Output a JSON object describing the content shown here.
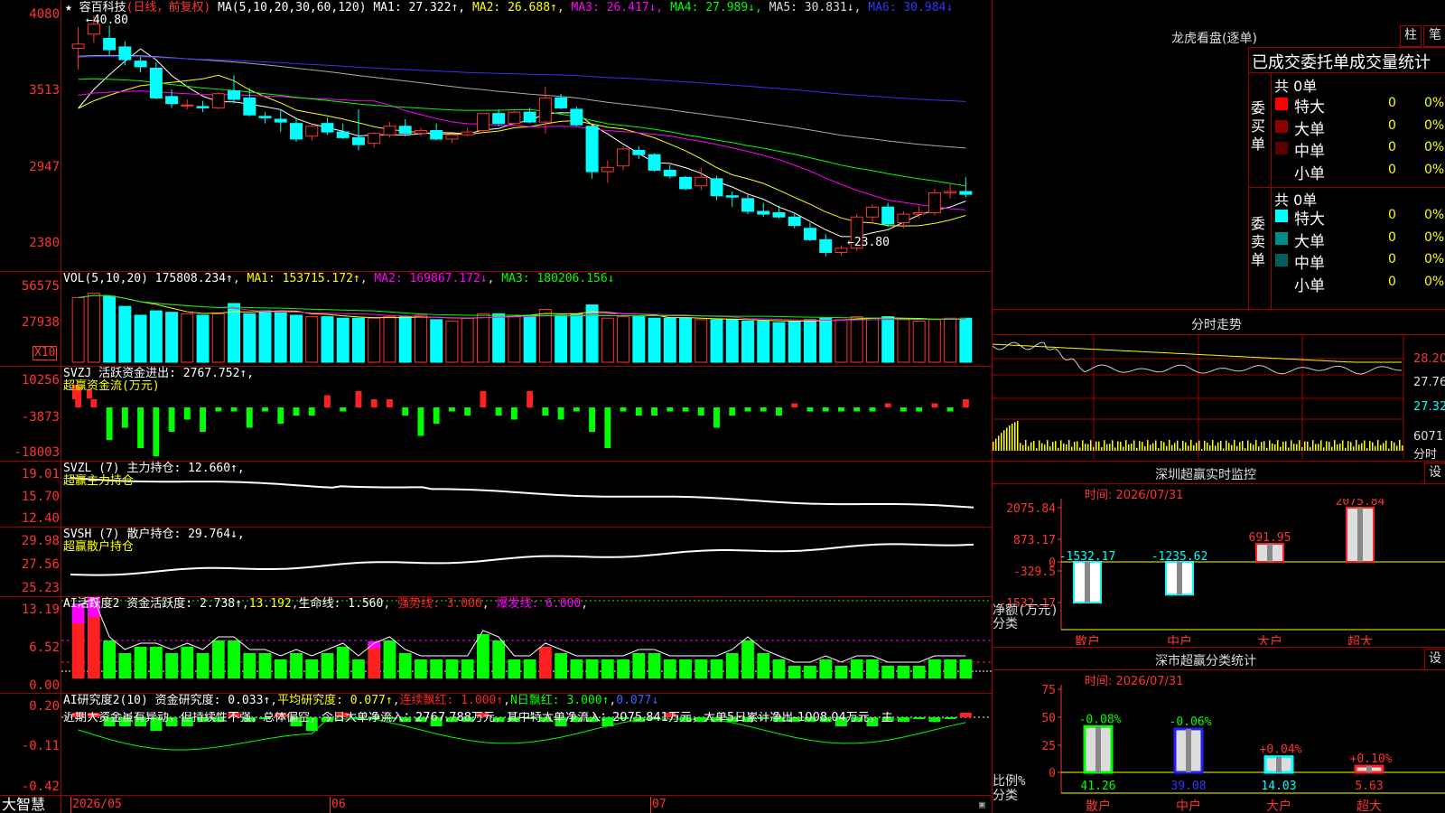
{
  "main": {
    "header": {
      "star": "★",
      "name": "容百科技",
      "mode": "(日线，前复权)",
      "ma_title": "MA(5,10,20,30,60,120)",
      "items": [
        {
          "text": "MA1: 27.322↑",
          "color": "#ffffff"
        },
        {
          "text": "MA2: 26.688↑",
          "color": "#ffff00"
        },
        {
          "text": "MA3: 26.417↓",
          "color": "#ff00ff"
        },
        {
          "text": "MA4: 27.989↓",
          "color": "#00ff00"
        },
        {
          "text": "MA5: 30.831↓",
          "color": "#dddddd"
        },
        {
          "text": "MA6: 30.984↓",
          "color": "#3333ff"
        }
      ]
    },
    "y_ticks": [
      "4080",
      "3513",
      "2947",
      "2380"
    ],
    "high_note": "40.80",
    "low_note": "←23.80"
  },
  "vol": {
    "title": "VOL(5,10,20)",
    "value": "175808.234↑",
    "ma1": "MA1: 153715.172↑",
    "ma2": "MA2: 169867.172↓",
    "ma3": "MA3: 180206.156↓",
    "y_ticks": [
      "56575",
      "27938"
    ],
    "unit": "X10"
  },
  "svzj": {
    "title": "SVZJ  活跃资金进出: 2767.752↑,",
    "subtitle": "超赢资金流(万元)",
    "y_ticks": [
      "10256",
      "-3873",
      "-18003"
    ]
  },
  "svzl": {
    "title": "SVZL (7) 主力持仓: 12.660↑,",
    "subtitle": "超赢主力持仓",
    "y_ticks": [
      "19.01",
      "15.70",
      "12.40"
    ]
  },
  "svsh": {
    "title": "SVSH (7) 散户持仓: 29.764↓,",
    "subtitle": "超赢散户持仓",
    "y_ticks": [
      "29.98",
      "27.56",
      "25.23"
    ]
  },
  "ai1": {
    "title": "AI活跃度2 资金活跃度: 2.738↑",
    "v2": "13.192",
    "life": "生命线: 1.560",
    "strong": "强势线: 3.000",
    "burst": "爆发线: 6.000",
    "y_ticks": [
      "13.19",
      "6.52",
      "0.00"
    ]
  },
  "ai2": {
    "title": "AI研究度2(10) 资金研究度: 0.033↑",
    "avg": "平均研究度: 0.077↑",
    "cont": "连续飘红: 1.000↑",
    "nday": "N日飘红: 3.000↑",
    "last": "0.077↓",
    "comment": "近期大资金虽有异动，但持续性不强，总体偏空，今日大单净流入：2767.788万元，其中特大单净流入：2075.841万元，大单5日累计净出-1008.04万元，主",
    "y_ticks": [
      "0.20",
      "-0.11",
      "-0.42"
    ]
  },
  "bottom": {
    "brand": "大智慧",
    "dates": [
      "2026/05",
      "06",
      "07"
    ]
  },
  "right": {
    "dragon": {
      "title": "龙虎看盘(逐单)",
      "btn1": "柱",
      "btn2": "笔",
      "header": "已成交委托单成交量统计",
      "buy_label": "委买单",
      "sell_label": "委卖单",
      "buy_total": "共 0单",
      "sell_total": "共 0单",
      "rows": [
        {
          "name": "特大",
          "count": "0",
          "pct": "0%",
          "color": "#ff0000"
        },
        {
          "name": "大单",
          "count": "0",
          "pct": "0%",
          "color": "#8b0000"
        },
        {
          "name": "中单",
          "count": "0",
          "pct": "0%",
          "color": "#5a0000"
        },
        {
          "name": "小单",
          "count": "0",
          "pct": "0%",
          "color": "#000000"
        }
      ],
      "sell_rows": [
        {
          "name": "特大",
          "count": "0",
          "pct": "0%",
          "color": "#00ffff"
        },
        {
          "name": "大单",
          "count": "0",
          "pct": "0%",
          "color": "#008b8b"
        },
        {
          "name": "中单",
          "count": "0",
          "pct": "0%",
          "color": "#006060"
        },
        {
          "name": "小单",
          "count": "0",
          "pct": "0%",
          "color": "#000000"
        }
      ]
    },
    "intraday": {
      "title": "分时走势",
      "ticks": [
        "28.20",
        "27.76",
        "27.32"
      ],
      "vol_tick": "6071",
      "vol_label": "分时"
    },
    "monitor": {
      "title": "深圳超赢实时监控",
      "btn": "设",
      "time": "时间: 2026/07/31",
      "y_ticks": [
        "2075.84",
        "873.17",
        "0",
        "-329.5",
        "-1532.17"
      ],
      "axis_label": "净额(万元)",
      "cat_label": "分类",
      "bars": [
        {
          "cat": "散户",
          "value": -1532.17,
          "label": "-1532.17"
        },
        {
          "cat": "中户",
          "value": -1235.62,
          "label": "-1235.62"
        },
        {
          "cat": "大户",
          "value": 691.95,
          "label": "691.95"
        },
        {
          "cat": "超大",
          "value": 2075.84,
          "label": "2075.84"
        }
      ]
    },
    "classify": {
      "title": "深市超赢分类统计",
      "btn": "设",
      "time": "时间: 2026/07/31",
      "y_ticks": [
        "75",
        "50",
        "25",
        "0"
      ],
      "axis_label": "比例%",
      "cat_label": "分类",
      "bars": [
        {
          "cat": "散户",
          "value": 41.26,
          "label": "41.26",
          "delta": "-0.08%",
          "color": "#00ff00"
        },
        {
          "cat": "中户",
          "value": 39.08,
          "label": "39.08",
          "delta": "-0.06%",
          "color": "#2020ff"
        },
        {
          "cat": "大户",
          "value": 14.03,
          "label": "14.03",
          "delta": "+0.04%",
          "color": "#00ffff"
        },
        {
          "cat": "超大",
          "value": 5.63,
          "label": "5.63",
          "delta": "+0.10%",
          "color": "#ff2020"
        }
      ]
    }
  },
  "chart_data": {
    "type": "candlestick",
    "title": "容百科技 (日线，前复权)",
    "note": "OHLC values in price units, in display order left to right",
    "ohlc": [
      [
        38.5,
        40.0,
        37.0,
        38.8
      ],
      [
        39.5,
        40.8,
        38.9,
        40.2
      ],
      [
        39.2,
        40.1,
        38.0,
        38.4
      ],
      [
        38.6,
        39.0,
        37.3,
        37.7
      ],
      [
        37.6,
        37.9,
        36.8,
        37.2
      ],
      [
        37.1,
        37.5,
        34.9,
        35.0
      ],
      [
        35.1,
        35.6,
        34.3,
        34.6
      ],
      [
        34.5,
        34.9,
        34.2,
        34.5
      ],
      [
        34.4,
        34.8,
        34.0,
        34.3
      ],
      [
        34.3,
        35.4,
        34.2,
        35.3
      ],
      [
        35.5,
        36.6,
        34.6,
        34.9
      ],
      [
        35.0,
        35.7,
        33.7,
        33.8
      ],
      [
        33.7,
        34.0,
        33.2,
        33.6
      ],
      [
        33.5,
        34.2,
        32.6,
        33.3
      ],
      [
        33.2,
        33.6,
        31.9,
        32.1
      ],
      [
        32.3,
        33.2,
        32.0,
        33.0
      ],
      [
        33.2,
        33.6,
        32.4,
        32.6
      ],
      [
        32.6,
        33.2,
        32.1,
        32.2
      ],
      [
        32.2,
        34.2,
        31.3,
        31.7
      ],
      [
        31.8,
        32.6,
        31.5,
        32.5
      ],
      [
        32.4,
        33.3,
        32.2,
        33.0
      ],
      [
        33.0,
        33.5,
        32.3,
        32.5
      ],
      [
        32.5,
        32.9,
        32.3,
        32.7
      ],
      [
        32.7,
        33.2,
        32.0,
        32.1
      ],
      [
        32.1,
        32.5,
        31.8,
        32.4
      ],
      [
        32.4,
        32.9,
        32.3,
        32.6
      ],
      [
        32.7,
        33.9,
        32.6,
        33.9
      ],
      [
        33.9,
        34.2,
        33.0,
        33.2
      ],
      [
        33.2,
        34.1,
        33.1,
        34.0
      ],
      [
        34.0,
        34.3,
        33.2,
        33.3
      ],
      [
        33.3,
        35.8,
        32.5,
        35.0
      ],
      [
        35.0,
        35.3,
        34.2,
        34.3
      ],
      [
        34.2,
        34.4,
        33.0,
        33.1
      ],
      [
        33.0,
        33.1,
        29.3,
        29.8
      ],
      [
        29.8,
        30.6,
        29.0,
        30.1
      ],
      [
        30.2,
        31.6,
        29.9,
        31.4
      ],
      [
        31.3,
        31.6,
        30.7,
        31.0
      ],
      [
        31.0,
        31.1,
        29.8,
        29.9
      ],
      [
        29.9,
        30.3,
        29.3,
        29.5
      ],
      [
        29.4,
        29.5,
        28.5,
        28.6
      ],
      [
        28.8,
        30.1,
        28.5,
        29.4
      ],
      [
        29.3,
        29.5,
        27.8,
        28.1
      ],
      [
        28.1,
        28.4,
        27.3,
        28.0
      ],
      [
        27.9,
        28.2,
        26.8,
        27.0
      ],
      [
        27.0,
        27.6,
        26.6,
        26.8
      ],
      [
        26.9,
        27.4,
        26.5,
        26.6
      ],
      [
        26.6,
        26.9,
        25.8,
        26.0
      ],
      [
        25.8,
        26.2,
        24.9,
        25.0
      ],
      [
        25.0,
        25.4,
        23.8,
        24.1
      ],
      [
        24.1,
        24.6,
        23.9,
        24.4
      ],
      [
        24.4,
        26.8,
        24.2,
        26.6
      ],
      [
        26.6,
        27.5,
        26.2,
        27.3
      ],
      [
        27.3,
        27.6,
        25.9,
        26.1
      ],
      [
        26.2,
        27.0,
        25.8,
        26.8
      ],
      [
        26.8,
        27.4,
        26.5,
        26.9
      ],
      [
        26.9,
        28.6,
        26.7,
        28.3
      ],
      [
        28.3,
        29.0,
        27.9,
        28.4
      ],
      [
        28.4,
        29.4,
        28.0,
        28.2
      ]
    ],
    "volume": [
      44000,
      47000,
      45000,
      38000,
      32000,
      35000,
      34000,
      33000,
      32000,
      33000,
      40000,
      33000,
      35000,
      34000,
      32000,
      31000,
      31000,
      30000,
      30000,
      30000,
      31000,
      31000,
      32000,
      29000,
      28000,
      30000,
      33000,
      33000,
      32000,
      32000,
      36000,
      32000,
      33000,
      39000,
      30000,
      31000,
      31000,
      30000,
      30000,
      30000,
      29000,
      29000,
      29000,
      28000,
      28000,
      27000,
      28000,
      29000,
      30000,
      29000,
      31000,
      30000,
      31000,
      29000,
      28000,
      29000,
      30000,
      30000
    ],
    "ylim": [
      23.8,
      40.8
    ]
  }
}
